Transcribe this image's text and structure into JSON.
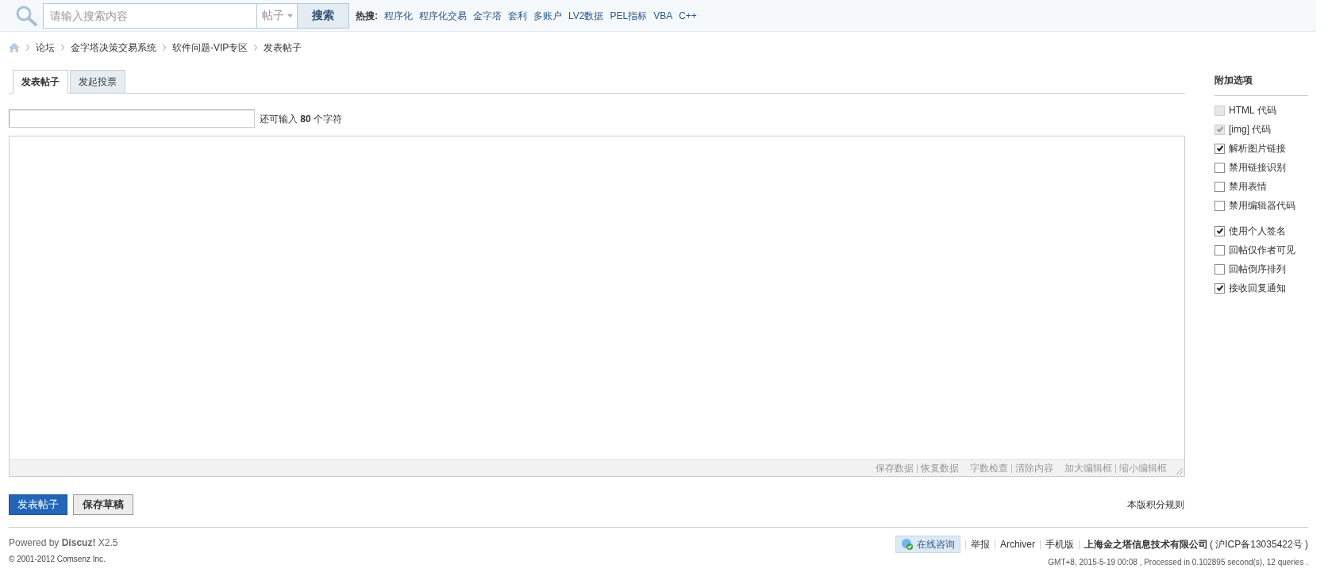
{
  "search": {
    "placeholder": "请输入搜索内容",
    "scope": "帖子",
    "button": "搜索",
    "hot_label": "热搜:",
    "hot_terms": [
      "程序化",
      "程序化交易",
      "金字塔",
      "套利",
      "多账户",
      "LV2数据",
      "PEL指标",
      "VBA",
      "C++"
    ]
  },
  "breadcrumbs": [
    "论坛",
    "金字塔决策交易系统",
    "软件问题-VIP专区",
    "发表帖子"
  ],
  "tabs": [
    {
      "label": "发表帖子",
      "selected": true
    },
    {
      "label": "发起投票",
      "selected": false
    }
  ],
  "title_field": {
    "hint_before": "还可输入",
    "count": "80",
    "hint_after": "个字符"
  },
  "editor_actions": [
    [
      "保存数据",
      "恢复数据"
    ],
    [
      "字数检查",
      "清除内容"
    ],
    [
      "加大编辑框",
      "缩小编辑框"
    ]
  ],
  "buttons": {
    "submit": "发表帖子",
    "draft": "保存草稿"
  },
  "rules_link": "本版积分规则",
  "options": {
    "title": "附加选项",
    "groups": [
      [
        {
          "label": "HTML 代码",
          "checked": false,
          "disabled": true
        },
        {
          "label": "[img] 代码",
          "checked": true,
          "disabled": true
        },
        {
          "label": "解析图片链接",
          "checked": true,
          "disabled": false
        },
        {
          "label": "禁用链接识别",
          "checked": false,
          "disabled": false
        },
        {
          "label": "禁用表情",
          "checked": false,
          "disabled": false
        },
        {
          "label": "禁用编辑器代码",
          "checked": false,
          "disabled": false
        }
      ],
      [
        {
          "label": "使用个人签名",
          "checked": true,
          "disabled": false
        },
        {
          "label": "回帖仅作者可见",
          "checked": false,
          "disabled": false
        },
        {
          "label": "回帖倒序排列",
          "checked": false,
          "disabled": false
        },
        {
          "label": "接收回复通知",
          "checked": true,
          "disabled": false
        }
      ]
    ]
  },
  "footer": {
    "powered": "Powered by **Discuz!** X2.5",
    "copyright": "© 2001-2012 Comsenz Inc.",
    "consult": "在线咨询",
    "links": [
      "举报",
      "Archiver",
      "手机版"
    ],
    "company": "上海金之塔信息技术有限公司",
    "icp": "( 沪ICP备13035422号 )",
    "stats": "GMT+8, 2015-5-19 00:08 , Processed in 0.102895 second(s), 12 queries ."
  }
}
